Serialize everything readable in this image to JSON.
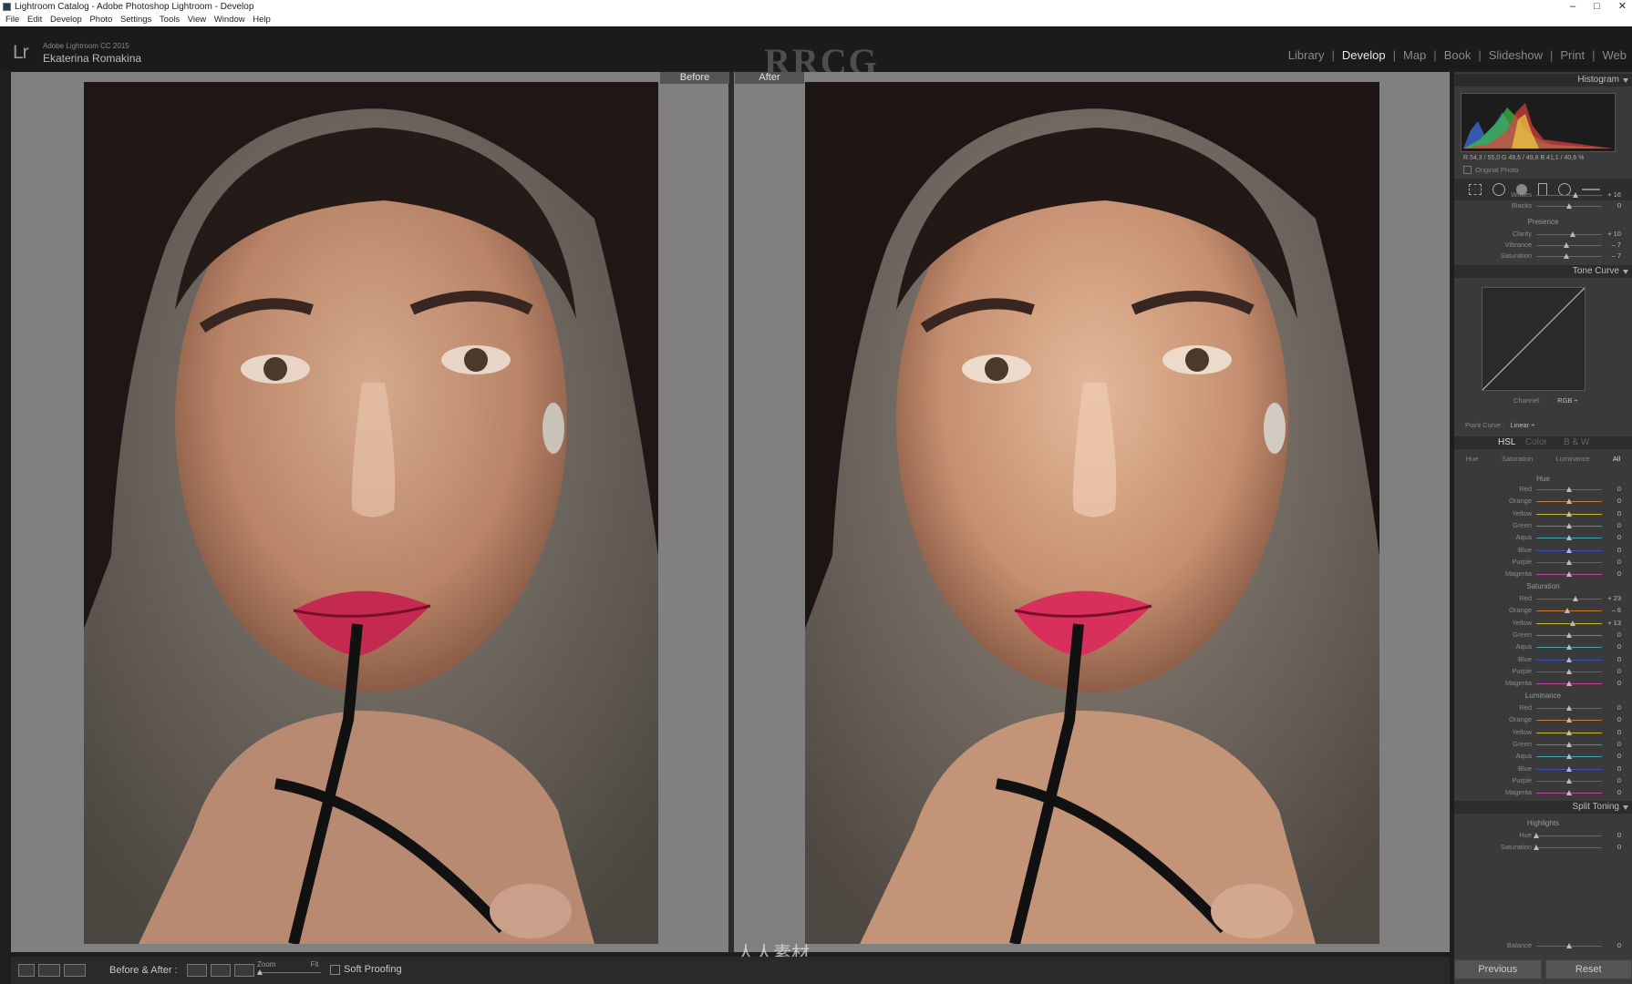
{
  "window": {
    "title": "Lightroom Catalog - Adobe Photoshop Lightroom - Develop",
    "controls": [
      "–",
      "□",
      "✕"
    ]
  },
  "menu": [
    "File",
    "Edit",
    "Develop",
    "Photo",
    "Settings",
    "Tools",
    "View",
    "Window",
    "Help"
  ],
  "identity": {
    "logo": "Lr",
    "version": "Adobe Lightroom CC 2015",
    "name": "Ekaterina Romakina"
  },
  "watermark": "RRCG",
  "modules": {
    "items": [
      "Library",
      "Develop",
      "Map",
      "Book",
      "Slideshow",
      "Print",
      "Web"
    ],
    "active": "Develop"
  },
  "view": {
    "before_label": "Before",
    "after_label": "After"
  },
  "toolbar": {
    "before_after_label": "Before & After :",
    "zoom_label": "Zoom",
    "fit_label": "Fit",
    "soft_proofing_label": "Soft Proofing"
  },
  "bottom_watermark": "人人素材",
  "right_panel": {
    "histogram": {
      "title": "Histogram",
      "readout": "R 54,3 / 55,0   G 49,6 / 49,8   B 41,1 / 40,6 %",
      "original_photo": "Original Photo"
    },
    "basic": {
      "sliders": [
        {
          "label": "Whites",
          "value": "+ 16",
          "pos": 0.6
        },
        {
          "label": "Blacks",
          "value": "0",
          "pos": 0.5
        }
      ],
      "presence_title": "Presence",
      "presence": [
        {
          "label": "Clarity",
          "value": "+ 10",
          "pos": 0.55
        },
        {
          "label": "Vibrance",
          "value": "– 7",
          "pos": 0.46
        },
        {
          "label": "Saturation",
          "value": "– 7",
          "pos": 0.46
        }
      ]
    },
    "tone_curve": {
      "title": "Tone Curve",
      "channel_label": "Channel :",
      "channel_value": "RGB ÷",
      "point_curve_label": "Point Curve :",
      "point_curve_value": "Linear ÷"
    },
    "hsl": {
      "title": "HSL",
      "alt1": "Color",
      "alt2": "B & W",
      "tabs": [
        "Hue",
        "Saturation",
        "Luminance",
        "All"
      ],
      "hue_title": "Hue",
      "hue": [
        {
          "label": "Red",
          "value": "0",
          "pos": 0.5
        },
        {
          "label": "Orange",
          "value": "0",
          "pos": 0.5
        },
        {
          "label": "Yellow",
          "value": "0",
          "pos": 0.5
        },
        {
          "label": "Green",
          "value": "0",
          "pos": 0.5
        },
        {
          "label": "Aqua",
          "value": "0",
          "pos": 0.5
        },
        {
          "label": "Blue",
          "value": "0",
          "pos": 0.5
        },
        {
          "label": "Purple",
          "value": "0",
          "pos": 0.5
        },
        {
          "label": "Magenta",
          "value": "0",
          "pos": 0.5
        }
      ],
      "sat_title": "Saturation",
      "saturation": [
        {
          "label": "Red",
          "value": "+ 23",
          "pos": 0.6
        },
        {
          "label": "Orange",
          "value": "– 6",
          "pos": 0.47
        },
        {
          "label": "Yellow",
          "value": "+ 13",
          "pos": 0.56
        },
        {
          "label": "Green",
          "value": "0",
          "pos": 0.5
        },
        {
          "label": "Aqua",
          "value": "0",
          "pos": 0.5
        },
        {
          "label": "Blue",
          "value": "0",
          "pos": 0.5
        },
        {
          "label": "Purple",
          "value": "0",
          "pos": 0.5
        },
        {
          "label": "Magenta",
          "value": "0",
          "pos": 0.5
        }
      ],
      "lum_title": "Luminance",
      "luminance": [
        {
          "label": "Red",
          "value": "0",
          "pos": 0.5
        },
        {
          "label": "Orange",
          "value": "0",
          "pos": 0.5
        },
        {
          "label": "Yellow",
          "value": "0",
          "pos": 0.5
        },
        {
          "label": "Green",
          "value": "0",
          "pos": 0.5
        },
        {
          "label": "Aqua",
          "value": "0",
          "pos": 0.5
        },
        {
          "label": "Blue",
          "value": "0",
          "pos": 0.5
        },
        {
          "label": "Purple",
          "value": "0",
          "pos": 0.5
        },
        {
          "label": "Magenta",
          "value": "0",
          "pos": 0.5
        }
      ]
    },
    "split_toning": {
      "title": "Split Toning",
      "highlights_title": "Highlights",
      "sliders": [
        {
          "label": "Hue",
          "value": "0",
          "pos": 0.0
        },
        {
          "label": "Saturation",
          "value": "0",
          "pos": 0.0
        }
      ],
      "balance": {
        "label": "Balance",
        "value": "0",
        "pos": 0.5
      }
    },
    "previous_label": "Previous",
    "reset_label": "Reset"
  },
  "colors": {
    "hsl_track": [
      "#c04040",
      "#c87a30",
      "#c8b830",
      "#4aa048",
      "#40a8a8",
      "#4050c0",
      "#8a40b0",
      "#c040a0"
    ]
  }
}
